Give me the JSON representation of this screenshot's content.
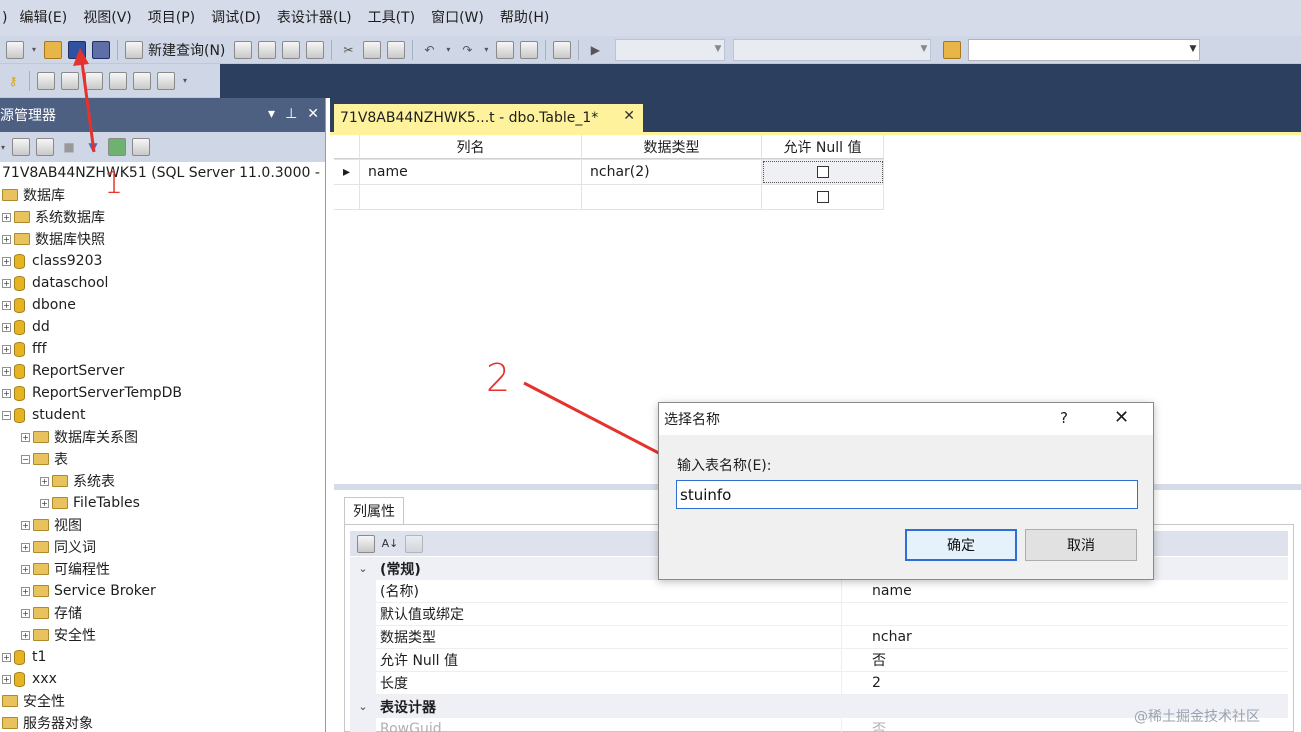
{
  "menu": [
    ")",
    "编辑(E)",
    "视图(V)",
    "项目(P)",
    "调试(D)",
    "表设计器(L)",
    "工具(T)",
    "窗口(W)",
    "帮助(H)"
  ],
  "toolbar": {
    "new_query_label": "新建查询(N)"
  },
  "object_explorer": {
    "title": "源管理器",
    "tree": [
      {
        "label": "71V8AB44NZHWK51 (SQL Server 11.0.3000 -",
        "indent": 0,
        "icon": "server-icon",
        "expander": ""
      },
      {
        "label": "数据库",
        "indent": 0,
        "icon": "folder-icon",
        "expander": ""
      },
      {
        "label": "系统数据库",
        "indent": 0,
        "icon": "folder-icon",
        "expander": "+"
      },
      {
        "label": "数据库快照",
        "indent": 0,
        "icon": "folder-icon",
        "expander": "+"
      },
      {
        "label": "class9203",
        "indent": 0,
        "icon": "database-icon",
        "expander": "+"
      },
      {
        "label": "dataschool",
        "indent": 0,
        "icon": "database-icon",
        "expander": "+"
      },
      {
        "label": "dbone",
        "indent": 0,
        "icon": "database-icon",
        "expander": "+"
      },
      {
        "label": "dd",
        "indent": 0,
        "icon": "database-icon",
        "expander": "+"
      },
      {
        "label": "fff",
        "indent": 0,
        "icon": "database-icon",
        "expander": "+"
      },
      {
        "label": "ReportServer",
        "indent": 0,
        "icon": "database-icon",
        "expander": "+"
      },
      {
        "label": "ReportServerTempDB",
        "indent": 0,
        "icon": "database-icon",
        "expander": "+"
      },
      {
        "label": "student",
        "indent": 0,
        "icon": "database-icon",
        "expander": "−"
      },
      {
        "label": "数据库关系图",
        "indent": 1,
        "icon": "folder-icon",
        "expander": "+"
      },
      {
        "label": "表",
        "indent": 1,
        "icon": "folder-icon",
        "expander": "−"
      },
      {
        "label": "系统表",
        "indent": 2,
        "icon": "folder-icon",
        "expander": "+"
      },
      {
        "label": "FileTables",
        "indent": 2,
        "icon": "folder-icon",
        "expander": "+"
      },
      {
        "label": "视图",
        "indent": 1,
        "icon": "folder-icon",
        "expander": "+"
      },
      {
        "label": "同义词",
        "indent": 1,
        "icon": "folder-icon",
        "expander": "+"
      },
      {
        "label": "可编程性",
        "indent": 1,
        "icon": "folder-icon",
        "expander": "+"
      },
      {
        "label": "Service Broker",
        "indent": 1,
        "icon": "folder-icon",
        "expander": "+"
      },
      {
        "label": "存储",
        "indent": 1,
        "icon": "folder-icon",
        "expander": "+"
      },
      {
        "label": "安全性",
        "indent": 1,
        "icon": "folder-icon",
        "expander": "+"
      },
      {
        "label": "t1",
        "indent": 0,
        "icon": "database-icon",
        "expander": "+"
      },
      {
        "label": "xxx",
        "indent": 0,
        "icon": "database-icon",
        "expander": "+"
      },
      {
        "label": "安全性",
        "indent": 0,
        "icon": "folder-icon",
        "expander": ""
      },
      {
        "label": "服务器对象",
        "indent": 0,
        "icon": "folder-icon",
        "expander": ""
      }
    ]
  },
  "document_tab": {
    "title": "71V8AB44NZHWK5...t - dbo.Table_1*",
    "close": "✕"
  },
  "designer": {
    "headers": [
      "列名",
      "数据类型",
      "允许 Null 值"
    ],
    "rows": [
      {
        "indicator": "▸",
        "name": "name",
        "type": "nchar(2)"
      },
      {
        "indicator": "",
        "name": "",
        "type": ""
      }
    ]
  },
  "properties": {
    "tab_label": "列属性",
    "rows": [
      {
        "kind": "cat",
        "name": "(常规)",
        "value": ""
      },
      {
        "kind": "prop",
        "name": "(名称)",
        "value": "name"
      },
      {
        "kind": "prop",
        "name": "默认值或绑定",
        "value": ""
      },
      {
        "kind": "prop",
        "name": "数据类型",
        "value": "nchar"
      },
      {
        "kind": "prop",
        "name": "允许 Null 值",
        "value": "否"
      },
      {
        "kind": "prop",
        "name": "长度",
        "value": "2"
      },
      {
        "kind": "cat",
        "name": "表设计器",
        "value": ""
      },
      {
        "kind": "dim",
        "name": "RowGuid",
        "value": "否"
      }
    ]
  },
  "dialog": {
    "title": "选择名称",
    "help": "?",
    "close": "✕",
    "label": "输入表名称(E):",
    "value": "stuinfo",
    "ok": "确定",
    "cancel": "取消"
  },
  "annotations": {
    "step1": "1",
    "step2": "2",
    "color": "#e5322d"
  },
  "watermark": "@稀土掘金技术社区"
}
